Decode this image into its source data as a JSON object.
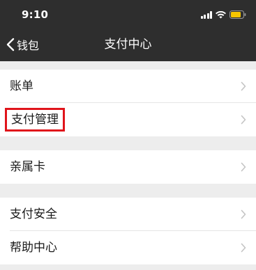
{
  "status_bar": {
    "time": "9:10",
    "battery_color": "#f7c600"
  },
  "nav": {
    "back_label": "钱包",
    "title": "支付中心"
  },
  "groups": [
    {
      "items": [
        {
          "label": "账单",
          "highlighted": false
        },
        {
          "label": "支付管理",
          "highlighted": true
        }
      ]
    },
    {
      "items": [
        {
          "label": "亲属卡",
          "highlighted": false
        }
      ]
    },
    {
      "items": [
        {
          "label": "支付安全",
          "highlighted": false
        },
        {
          "label": "帮助中心",
          "highlighted": false
        }
      ]
    }
  ],
  "colors": {
    "nav_background": "#2e2e2e",
    "page_background": "#ededed",
    "highlight_border": "#e0141b"
  }
}
